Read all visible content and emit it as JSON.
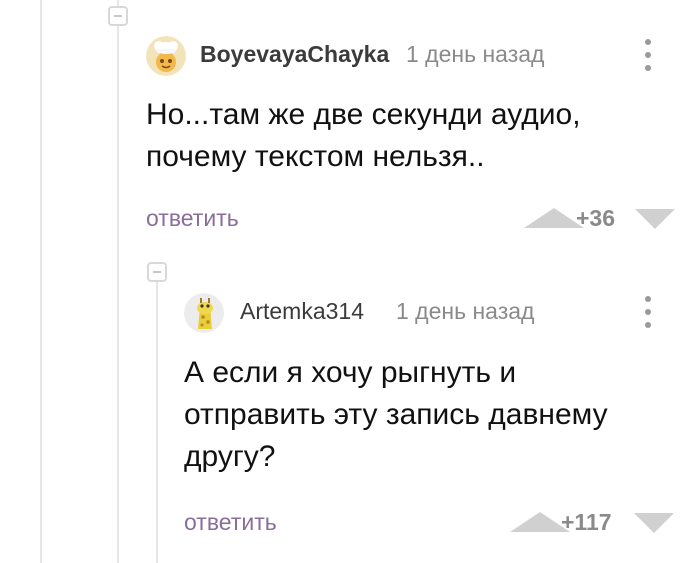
{
  "comments": [
    {
      "username": "BoyevayaChayka",
      "timestamp": "1 день назад",
      "text_lines": [
        "Но...там же две секунди аудио,",
        "почему текстом нельзя.."
      ],
      "reply_label": "ответить",
      "rating": "+36",
      "avatar_icon": "chef-hat-avatar"
    },
    {
      "username": "Artemka314",
      "timestamp": "1 день назад",
      "text_lines": [
        "А если я хочу рыгнуть и",
        "отправить эту запись давнему",
        "другу?"
      ],
      "reply_label": "ответить",
      "rating": "+117",
      "avatar_icon": "giraffe-avatar"
    }
  ],
  "colors": {
    "thread_line": "#e6e6e6",
    "reply_link": "#8a6d9a",
    "meta_text": "#8a8a8a",
    "vote_arrow": "#d0d0d0"
  }
}
